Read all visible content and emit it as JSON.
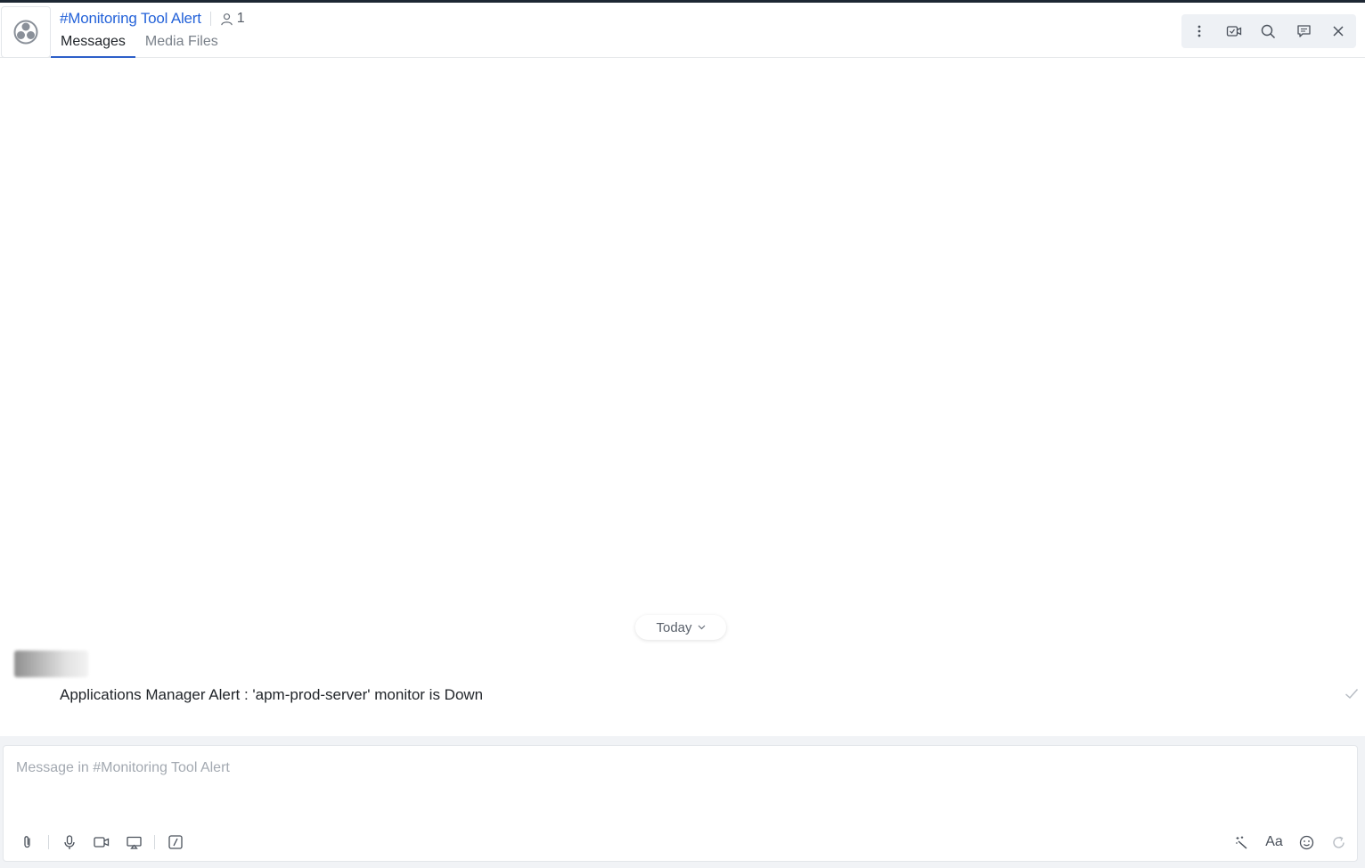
{
  "header": {
    "channel_title": "#Monitoring Tool Alert",
    "member_count": "1",
    "tabs": [
      {
        "label": "Messages",
        "active": true
      },
      {
        "label": "Media Files",
        "active": false
      }
    ],
    "toolbar_icons": [
      "more-vertical-icon",
      "video-call-icon",
      "search-icon",
      "thread-icon",
      "close-icon"
    ]
  },
  "messages": {
    "date_divider": "Today",
    "items": [
      {
        "sender": "",
        "text": "Applications Manager Alert : 'apm-prod-server' monitor is Down",
        "status": "sent"
      }
    ]
  },
  "composer": {
    "placeholder": "Message in #Monitoring Tool Alert",
    "value": "",
    "left_icons": [
      "attachment-icon",
      "microphone-icon",
      "video-message-icon",
      "screen-share-icon",
      "slash-command-icon"
    ],
    "right_icons": [
      "magic-wand-icon",
      "format-text-icon",
      "emoji-icon",
      "refresh-icon"
    ],
    "format_label": "Aa"
  },
  "colors": {
    "accent": "#2563d9",
    "tab_underline": "#2d5fc9",
    "toolbar_bg": "#eef1f5",
    "composer_bg": "#f1f3f6"
  }
}
